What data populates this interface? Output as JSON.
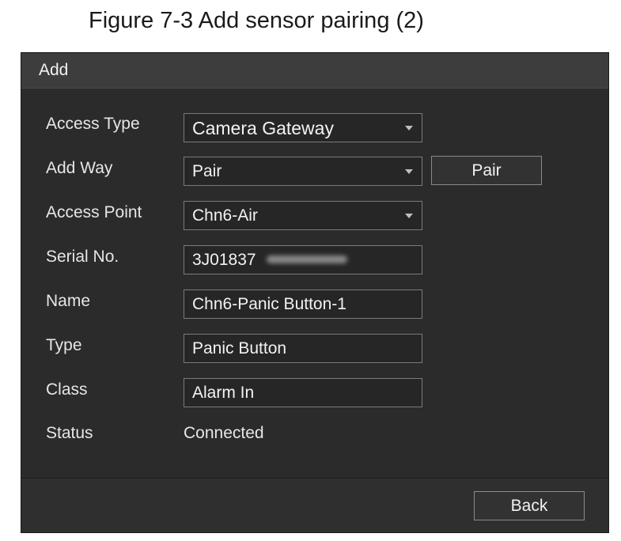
{
  "caption": "Figure 7-3 Add sensor pairing (2)",
  "dialog": {
    "title": "Add",
    "fields": {
      "access_type": {
        "label": "Access Type",
        "value": "Camera Gateway"
      },
      "add_way": {
        "label": "Add Way",
        "value": "Pair",
        "pair_button": "Pair"
      },
      "access_point": {
        "label": "Access Point",
        "value": "Chn6-Air"
      },
      "serial_no": {
        "label": "Serial No.",
        "value": "3J01837"
      },
      "name": {
        "label": "Name",
        "value": "Chn6-Panic Button-1"
      },
      "type": {
        "label": "Type",
        "value": "Panic Button"
      },
      "class": {
        "label": "Class",
        "value": "Alarm In"
      },
      "status": {
        "label": "Status",
        "value": "Connected"
      }
    },
    "back_button": "Back"
  },
  "colors": {
    "dialog_background": "#2b2b2b",
    "header_background": "#3d3d3d",
    "text": "#f2f2f2",
    "field_border": "#7a7a7a"
  },
  "icons": {
    "dropdown": "chevron-down-icon"
  }
}
